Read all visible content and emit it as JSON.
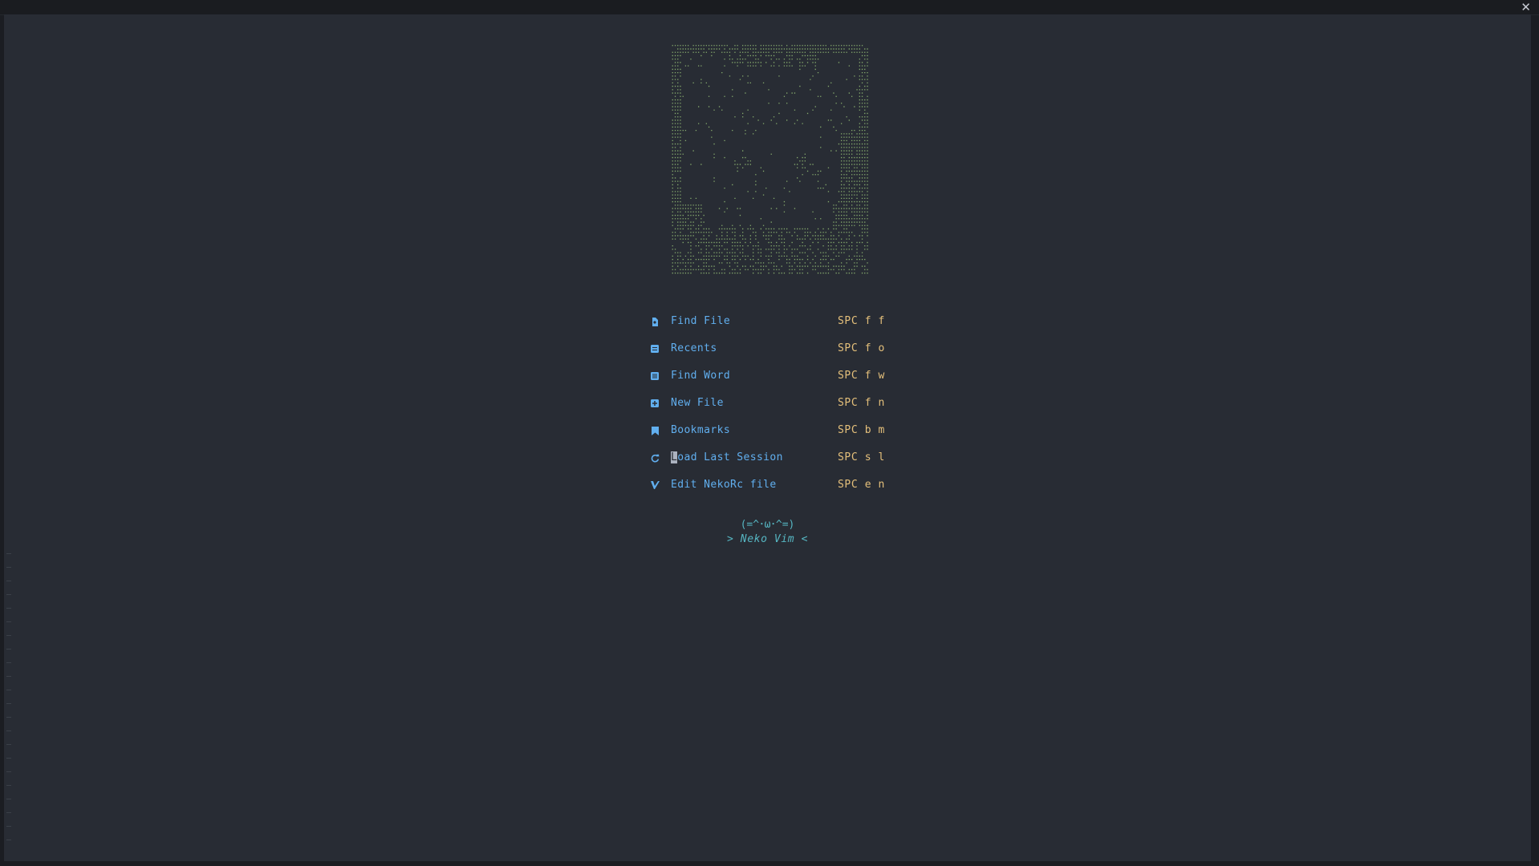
{
  "window": {
    "close_glyph": "✕"
  },
  "dashboard": {
    "menu": [
      {
        "icon": "search-file-icon",
        "label": "Find File",
        "key": "SPC f f"
      },
      {
        "icon": "recents-icon",
        "label": "Recents",
        "key": "SPC f o"
      },
      {
        "icon": "find-word-icon",
        "label": "Find Word",
        "key": "SPC f w"
      },
      {
        "icon": "new-file-icon",
        "label": "New File",
        "key": "SPC f n"
      },
      {
        "icon": "bookmark-icon",
        "label": "Bookmarks",
        "key": "SPC b m"
      },
      {
        "icon": "refresh-icon",
        "label": "Load Last Session",
        "label_rest": "oad Last Session",
        "label_first": "L",
        "key": "SPC s l"
      },
      {
        "icon": "edit-icon",
        "label": "Edit NekoRc file",
        "key": "SPC e n"
      }
    ],
    "footer": {
      "face": "(=^･ω･^=)",
      "tagline": "> Neko  Vim <"
    }
  },
  "colors": {
    "background": "#282c34",
    "label": "#61afef",
    "shortcut": "#e5c07b",
    "ascii_art": "#98c379",
    "footer": "#56b6c2"
  }
}
